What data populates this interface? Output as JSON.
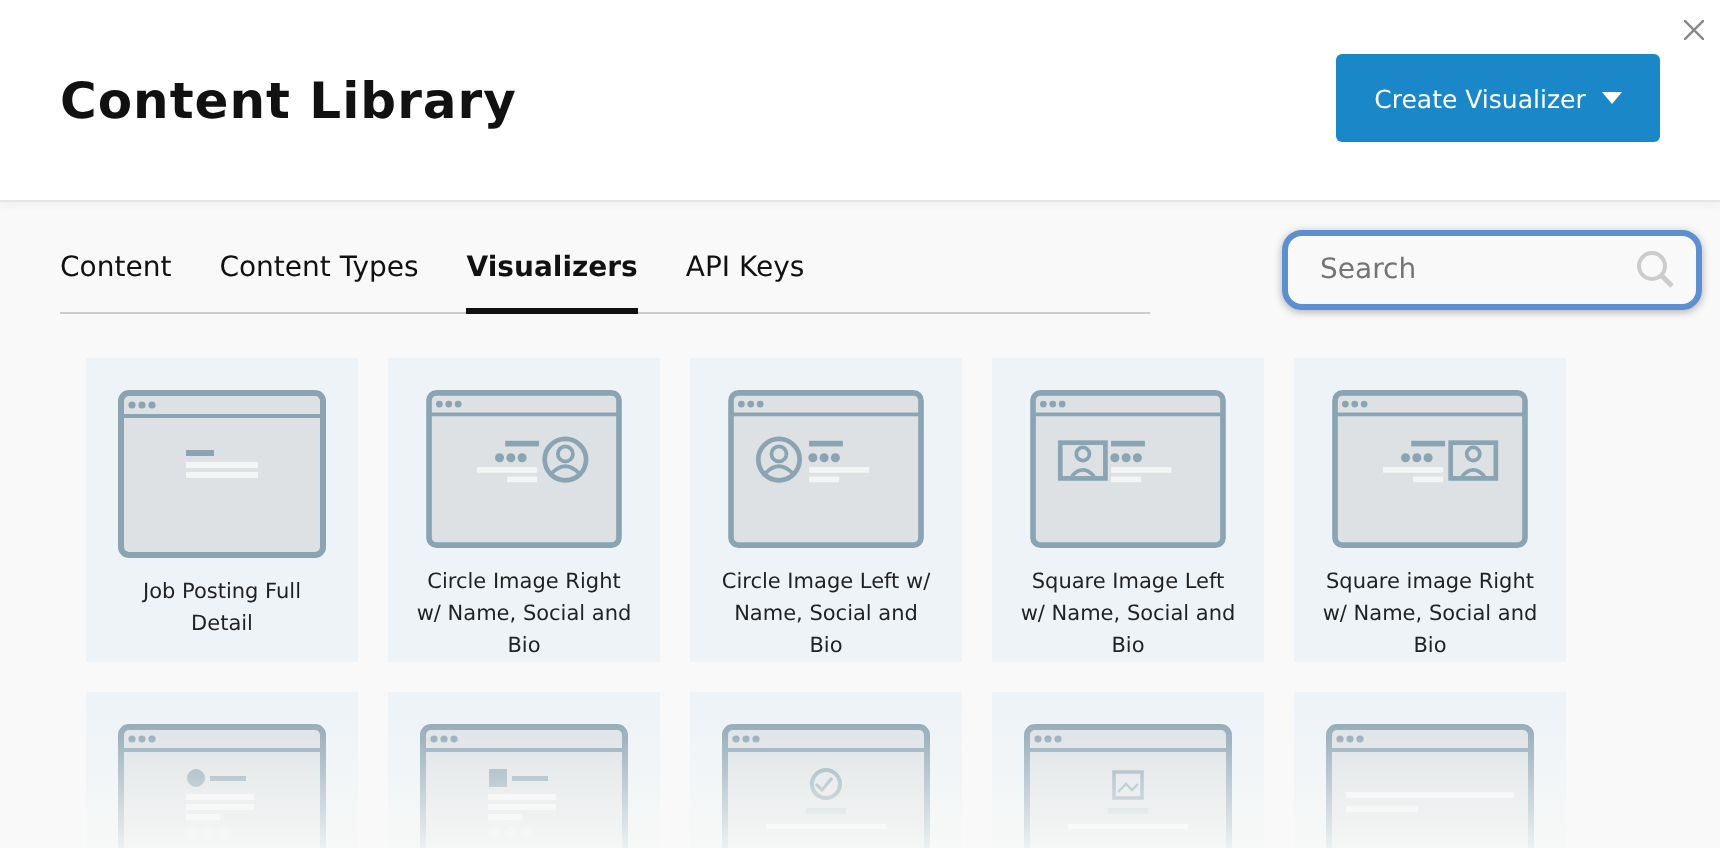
{
  "header": {
    "title": "Content Library",
    "create_button": {
      "label": "Create Visualizer"
    }
  },
  "tabs": [
    {
      "label": "Content",
      "selected": false
    },
    {
      "label": "Content Types",
      "selected": false
    },
    {
      "label": "Visualizers",
      "selected": true
    },
    {
      "label": "API Keys",
      "selected": false
    }
  ],
  "search": {
    "placeholder": "Search",
    "focused": true
  },
  "cards": [
    {
      "kind": "job-detail",
      "label": "Job Posting Full Detail"
    },
    {
      "kind": "circle-right",
      "label": "Circle Image Right w/ Name, Social and Bio"
    },
    {
      "kind": "circle-left",
      "label": "Circle Image Left w/ Name, Social and Bio"
    },
    {
      "kind": "square-left",
      "label": "Square Image Left w/ Name, Social and Bio"
    },
    {
      "kind": "square-right",
      "label": "Square image Right w/ Name, Social and Bio"
    },
    {
      "kind": "circle-list"
    },
    {
      "kind": "square-list"
    },
    {
      "kind": "round-media"
    },
    {
      "kind": "image-media"
    },
    {
      "kind": "text-only"
    }
  ]
}
